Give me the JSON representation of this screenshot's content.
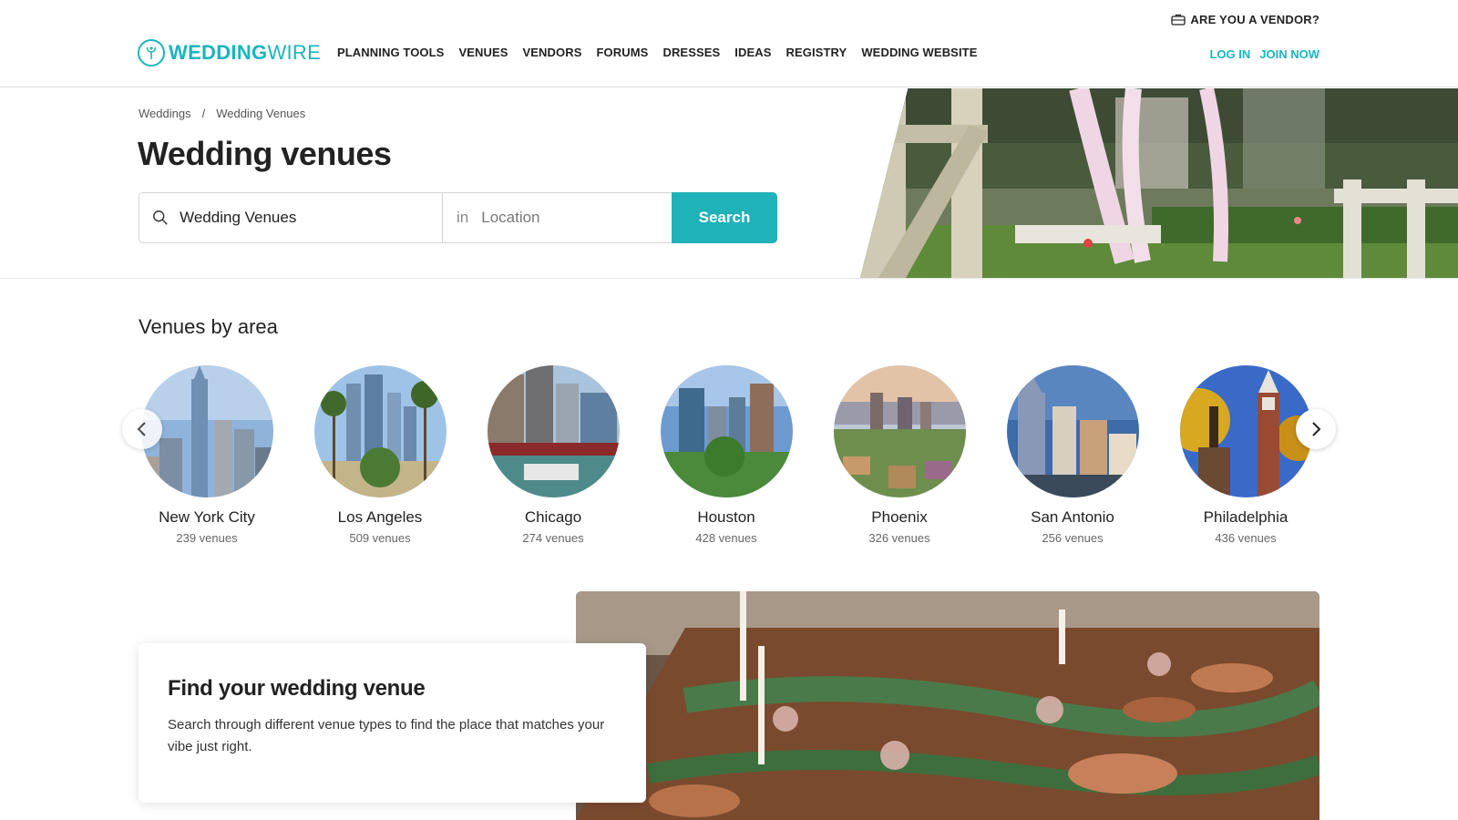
{
  "header": {
    "vendor_link": "ARE YOU A VENDOR?",
    "logo_bold": "WEDDING",
    "logo_light": "WIRE",
    "nav": [
      "PLANNING TOOLS",
      "VENUES",
      "VENDORS",
      "FORUMS",
      "DRESSES",
      "IDEAS",
      "REGISTRY",
      "WEDDING WEBSITE"
    ],
    "login": "LOG IN",
    "join": "JOIN NOW"
  },
  "breadcrumb": {
    "home": "Weddings",
    "separator": "/",
    "current": "Wedding Venues"
  },
  "hero": {
    "title": "Wedding venues",
    "search_value": "Wedding Venues",
    "in_label": "in",
    "location_placeholder": "Location",
    "search_button": "Search"
  },
  "areas": {
    "title": "Venues by area",
    "cities": [
      {
        "name": "New York City",
        "count": "239 venues"
      },
      {
        "name": "Los Angeles",
        "count": "509 venues"
      },
      {
        "name": "Chicago",
        "count": "274 venues"
      },
      {
        "name": "Houston",
        "count": "428 venues"
      },
      {
        "name": "Phoenix",
        "count": "326 venues"
      },
      {
        "name": "San Antonio",
        "count": "256 venues"
      },
      {
        "name": "Philadelphia",
        "count": "436 venues"
      }
    ]
  },
  "find": {
    "title": "Find your wedding venue",
    "text": "Search through different venue types to find the place that matches your vibe just right."
  },
  "colors": {
    "brand": "#19b5bc",
    "button": "#1fb2b8"
  },
  "icons": [
    "briefcase-icon",
    "logo-icon",
    "search-icon",
    "chevron-left-icon",
    "chevron-right-icon"
  ]
}
